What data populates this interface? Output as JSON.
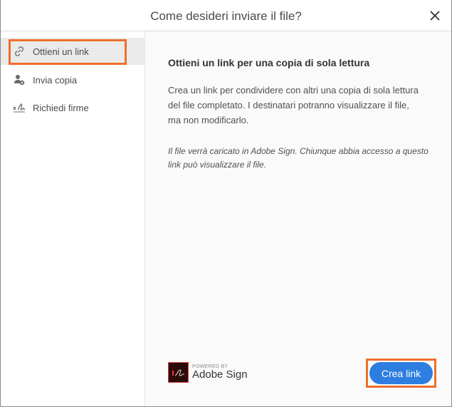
{
  "dialog": {
    "title": "Come desideri inviare il file?"
  },
  "sidebar": {
    "items": [
      {
        "label": "Ottieni un link",
        "icon": "link-icon",
        "selected": true
      },
      {
        "label": "Invia copia",
        "icon": "person-add-icon",
        "selected": false
      },
      {
        "label": "Richiedi firme",
        "icon": "signature-icon",
        "selected": false
      }
    ]
  },
  "main": {
    "heading": "Ottieni un link per una copia di sola lettura",
    "description": "Crea un link per condividere con altri una copia di sola lettura del file completato. I destinatari potranno visualizzare il file, ma non modificarlo.",
    "note": "Il file verrà caricato in Adobe Sign. Chiunque abbia accesso a questo link può visualizzare il file.",
    "powered_by": "POWERED BY",
    "brand": "Adobe Sign",
    "action_label": "Crea link"
  },
  "colors": {
    "accent": "#2d7ee0",
    "highlight": "#f06e2a"
  }
}
